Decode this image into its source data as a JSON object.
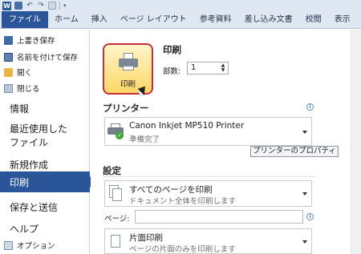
{
  "ribbon": {
    "tabs": [
      "ファイル",
      "ホーム",
      "挿入",
      "ページ レイアウト",
      "参考資料",
      "差し込み文書",
      "校閲",
      "表示"
    ]
  },
  "nav": {
    "small_items": [
      {
        "label": "上書き保存",
        "icon": "save-icon"
      },
      {
        "label": "名前を付けて保存",
        "icon": "save-as-icon"
      },
      {
        "label": "開く",
        "icon": "open-folder-icon"
      },
      {
        "label": "閉じる",
        "icon": "close-document-icon"
      }
    ],
    "info": "情報",
    "recent": "最近使用した\nファイル",
    "new": "新規作成",
    "print": "印刷",
    "save_send": "保存と送信",
    "help": "ヘルプ",
    "options": "オプション"
  },
  "print": {
    "button_label": "印刷",
    "title": "印刷",
    "copies_label": "部数:",
    "copies_value": "1"
  },
  "printer": {
    "section": "プリンター",
    "name": "Canon Inkjet MP510 Printer",
    "status": "準備完了",
    "properties_link": "プリンターのプロパティ"
  },
  "settings": {
    "section": "設定",
    "range_title": "すべてのページを印刷",
    "range_sub": "ドキュメント全体を印刷します",
    "pages_label": "ページ:",
    "pages_value": "",
    "sides_title": "片面印刷",
    "sides_sub": "ページの片面のみを印刷します"
  },
  "colors": {
    "accent": "#2a5699",
    "print_button_border": "#c2313b",
    "print_button_fill": "#ffd766"
  }
}
